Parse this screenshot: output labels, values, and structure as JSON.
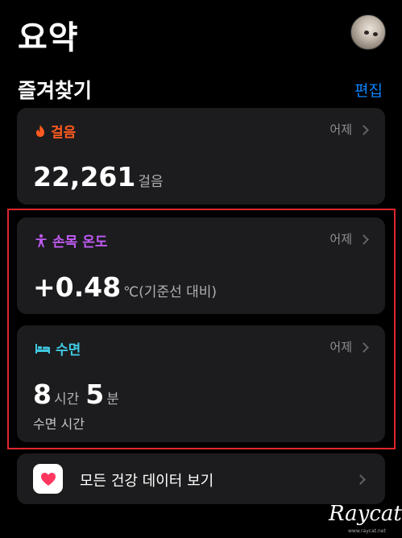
{
  "header": {
    "title": "요약"
  },
  "favorites": {
    "title": "즐겨찾기",
    "edit_label": "편집",
    "steps": {
      "label": "걸음",
      "when": "어제",
      "value": "22,261",
      "unit": "걸음",
      "color": "#ff5a1f",
      "icon": "flame-icon"
    },
    "wrist_temp": {
      "label": "손목 온도",
      "when": "어제",
      "value": "+0.48",
      "unit": "℃(기준선 대비)",
      "color": "#bf5af2",
      "icon": "person-icon"
    },
    "sleep": {
      "label": "수면",
      "when": "어제",
      "hours": "8",
      "hours_unit": "시간",
      "minutes": "5",
      "minutes_unit": "분",
      "sub": "수면 시간",
      "color": "#40c8e0",
      "icon": "bed-icon"
    }
  },
  "all_data": {
    "label": "모든 건강 데이터 보기",
    "icon": "heart-icon"
  },
  "watermark": {
    "text": "Raycat",
    "small": "www.raycat.net"
  }
}
